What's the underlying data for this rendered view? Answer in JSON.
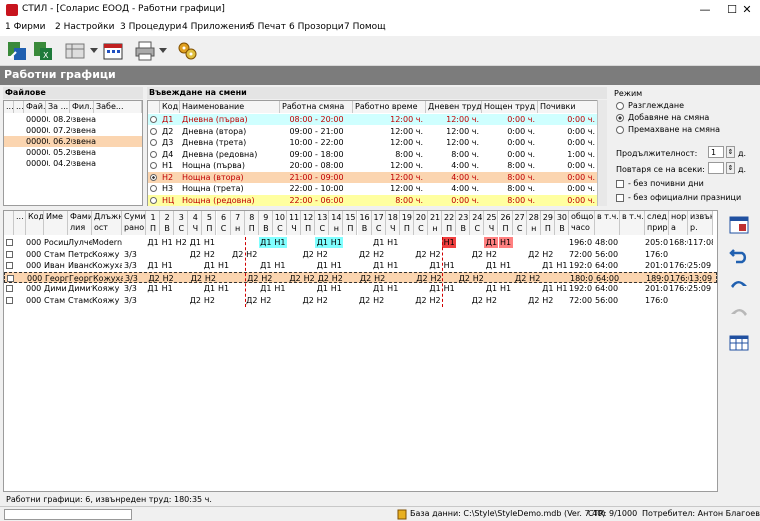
{
  "window": {
    "title": "СТИЛ - [Соларис ЕООД - Работни графици]",
    "min": "—",
    "max": "☐",
    "close": "✕"
  },
  "menu": [
    "1 Фирми",
    "2 Настройки",
    "3 Процедури",
    "4 Приложения",
    "5 Печат",
    "6 Прозорци",
    "7 Помощ"
  ],
  "section_title": "Работни графици",
  "files": {
    "title": "Файлове",
    "headers": [
      "...",
      "...",
      "Фай...",
      "За ...",
      "Фил...",
      "Забе..."
    ],
    "rows": [
      [
        "00000",
        ". 08.201",
        "звена:"
      ],
      [
        "00000",
        ". 07.201",
        "звена:"
      ],
      [
        "00000",
        ". 06.201",
        "звена:"
      ],
      [
        "00000",
        ". 05.201",
        "звена:"
      ],
      [
        "00000",
        ". 04.201",
        "звена:"
      ]
    ]
  },
  "shifts": {
    "title": "Въвеждане на смени",
    "headers": [
      "Код",
      "Наименование",
      "Работна смяна",
      "Работно време",
      "Дневен труд",
      "Нощен труд",
      "Почивки"
    ],
    "rows": [
      {
        "code": "Д1",
        "name": "Дневна (първа)",
        "shift": "08:00 - 20:00",
        "work": "12:00 ч.",
        "day": "12:00 ч.",
        "night": "0:00 ч.",
        "rest": "0:00 ч.",
        "bg": "#cfffff",
        "red": true
      },
      {
        "code": "Д2",
        "name": "Дневна (втора)",
        "shift": "09:00 - 21:00",
        "work": "12:00 ч.",
        "day": "12:00 ч.",
        "night": "0:00 ч.",
        "rest": "0:00 ч.",
        "bg": "#ffffff",
        "red": false
      },
      {
        "code": "Д3",
        "name": "Дневна (трета)",
        "shift": "10:00 - 22:00",
        "work": "12:00 ч.",
        "day": "12:00 ч.",
        "night": "0:00 ч.",
        "rest": "0:00 ч.",
        "bg": "#ffffff",
        "red": false
      },
      {
        "code": "Д4",
        "name": "Дневна (редовна)",
        "shift": "09:00 - 18:00",
        "work": "8:00 ч.",
        "day": "8:00 ч.",
        "night": "0:00 ч.",
        "rest": "1:00 ч.",
        "bg": "#ffffff",
        "red": false
      },
      {
        "code": "Н1",
        "name": "Нощна (първа)",
        "shift": "20:00 - 08:00",
        "work": "12:00 ч.",
        "day": "4:00 ч.",
        "night": "8:00 ч.",
        "rest": "0:00 ч.",
        "bg": "#ffffff",
        "red": false
      },
      {
        "code": "Н2",
        "name": "Нощна (втора)",
        "shift": "21:00 - 09:00",
        "work": "12:00 ч.",
        "day": "4:00 ч.",
        "night": "8:00 ч.",
        "rest": "0:00 ч.",
        "bg": "#fbd5b0",
        "red": true
      },
      {
        "code": "Н3",
        "name": "Нощна (трета)",
        "shift": "22:00 - 10:00",
        "work": "12:00 ч.",
        "day": "4:00 ч.",
        "night": "8:00 ч.",
        "rest": "0:00 ч.",
        "bg": "#ffffff",
        "red": false
      },
      {
        "code": "НЦ",
        "name": "Нощна (редовна)",
        "shift": "22:00 - 06:00",
        "work": "8:00 ч.",
        "day": "0:00 ч.",
        "night": "8:00 ч.",
        "rest": "0:00 ч.",
        "bg": "#ffffa0",
        "red": true
      }
    ]
  },
  "mode": {
    "title": "Режим",
    "options": [
      "Разглеждане",
      "Добавяне на смяна",
      "Премахване на смяна"
    ],
    "selected": 1,
    "duration_label": "Продължителност:",
    "duration_value": "1",
    "repeat_label": "Повтаря се на всеки:",
    "repeat_value": "",
    "unit": "д.",
    "chk1": "- без почивни дни",
    "chk2": "- без официални празници"
  },
  "schedule": {
    "headers": [
      "Код",
      "Име",
      "Фами лия",
      "Длъжн ост",
      "Суми- рано"
    ],
    "days": [
      "1",
      "2",
      "3",
      "4",
      "5",
      "6",
      "7",
      "8",
      "9",
      "10",
      "11",
      "12",
      "13",
      "14",
      "15",
      "16",
      "17",
      "18",
      "19",
      "20",
      "21",
      "22",
      "23",
      "24",
      "25",
      "26",
      "27",
      "28",
      "29",
      "30"
    ],
    "weekdays": [
      "П",
      "В",
      "С",
      "Ч",
      "П",
      "С",
      "н",
      "П",
      "В",
      "С",
      "Ч",
      "П",
      "С",
      "н",
      "П",
      "В",
      "С",
      "Ч",
      "П",
      "С",
      "н",
      "П",
      "В",
      "С",
      "Ч",
      "П",
      "С",
      "н",
      "П",
      "В"
    ],
    "totals_headers": [
      "общо часо",
      "в т.ч.",
      "в т.ч.",
      "след прир",
      "норм а",
      "извън р."
    ],
    "rows": [
      {
        "code": "000",
        "name": "Росиц",
        "family": "Лулче",
        "pos": "Modern",
        "sum": "",
        "cells": [
          "Д1",
          "Н1",
          "Н2",
          "Д1",
          "Н1",
          "",
          "",
          "",
          "Д1",
          "Н1",
          "",
          "",
          "Д1",
          "Н1",
          "",
          "",
          "Д1",
          "Н1",
          "",
          "",
          "",
          "Н1",
          "",
          "",
          "Д1",
          "Н1",
          "",
          "",
          "",
          ""
        ],
        "tot": [
          "196:0",
          "48:00",
          "",
          "205:0",
          "168:0",
          "117:08"
        ],
        "highlight": false
      },
      {
        "code": "000",
        "name": "Стам",
        "family": "Петро",
        "pos": "Кояжу",
        "sum": "3/3",
        "cells": [
          "",
          "",
          "",
          "Д2",
          "Н2",
          "",
          "Д2",
          "Н2",
          "",
          "",
          "",
          "Д2",
          "Н2",
          "",
          "",
          "Д2",
          "Н2",
          "",
          "",
          "Д2",
          "Н2",
          "",
          "",
          "Д2",
          "Н2",
          "",
          "",
          "Д2",
          "Н2",
          ""
        ],
        "tot": [
          "72:00",
          "56:00",
          "",
          "176:0",
          "",
          "",
          ""
        ],
        "highlight": false
      },
      {
        "code": "000",
        "name": "Иван",
        "family": "Иванс",
        "pos": "Кожуха",
        "sum": "3/3",
        "cells": [
          "Д1",
          "Н1",
          "",
          "",
          "Д1",
          "Н1",
          "",
          "",
          "Д1",
          "Н1",
          "",
          "",
          "Д1",
          "Н1",
          "",
          "",
          "Д1",
          "Н1",
          "",
          "",
          "Д1",
          "Н1",
          "",
          "",
          "Д1",
          "Н1",
          "",
          "",
          "Д1",
          "Н1"
        ],
        "tot": [
          "192:0",
          "64:00",
          "",
          "201:0",
          "176:0",
          "25:09"
        ],
        "highlight": false
      },
      {
        "code": "000",
        "name": "Георг",
        "family": "Георг",
        "pos": "Кожуха",
        "sum": "3/3",
        "cells": [
          "Д2",
          "Н2",
          "",
          "Д2",
          "Н2",
          "",
          "",
          "Д2",
          "Н2",
          "",
          "Д2",
          "Н2",
          "Д2",
          "Н2",
          "",
          "Д2",
          "Н2",
          "",
          "",
          "Д2",
          "Н2",
          "",
          "Д2",
          "Н2",
          "",
          "",
          "Д2",
          "Н2",
          "",
          ""
        ],
        "tot": [
          "180:0",
          "64:00",
          "",
          "189:0",
          "176:0",
          "13:09"
        ],
        "highlight": true
      },
      {
        "code": "000",
        "name": "Дими",
        "family": "Димит",
        "pos": "Кояжу",
        "sum": "3/3",
        "cells": [
          "Д1",
          "Н1",
          "",
          "",
          "Д1",
          "Н1",
          "",
          "",
          "Д1",
          "Н1",
          "",
          "",
          "Д1",
          "Н1",
          "",
          "",
          "Д1",
          "Н1",
          "",
          "",
          "Д1",
          "Н1",
          "",
          "",
          "Д1",
          "Н1",
          "",
          "",
          "Д1",
          "Н1"
        ],
        "tot": [
          "192:0",
          "64:00",
          "",
          "201:0",
          "176:0",
          "25:09"
        ],
        "highlight": false
      },
      {
        "code": "000",
        "name": "Стам",
        "family": "Стамс",
        "pos": "Кояжу",
        "sum": "3/3",
        "cells": [
          "",
          "",
          "",
          "Д2",
          "Н2",
          "",
          "",
          "Д2",
          "Н2",
          "",
          "",
          "Д2",
          "Н2",
          "",
          "",
          "Д2",
          "Н2",
          "",
          "",
          "Д2",
          "Н2",
          "",
          "",
          "Д2",
          "Н2",
          "",
          "",
          "Д2",
          "Н2",
          ""
        ],
        "tot": [
          "72:00",
          "56:00",
          "",
          "176:0",
          "",
          "",
          ""
        ],
        "highlight": false
      }
    ]
  },
  "summary": "Работни графици: 6, извънреден труд: 180:35 ч.",
  "status": {
    "db": "База данни: C:\\Style\\StyleDemo.mdb (Ver. 7.40)",
    "ctr": "CTR: 9/1000",
    "user": "Потребител: Антон Благоев"
  }
}
